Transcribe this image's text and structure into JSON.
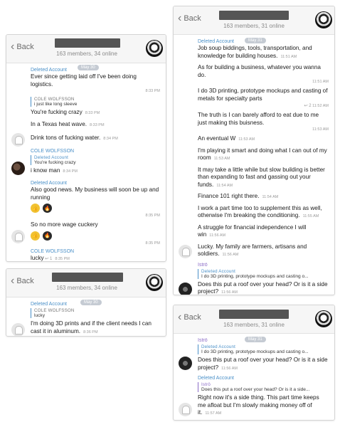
{
  "header": {
    "back_label": "Back",
    "members_a": "163 members, 34 online",
    "members_b": "163 members, 31 online"
  },
  "panel1": {
    "day": "May 30",
    "messages": [
      {
        "sender": "Deleted Account",
        "text": "Ever since getting laid off I've been doing logistics.",
        "time": "8:33 PM"
      },
      {
        "reply_name": "COLE WOLFSSON",
        "reply_text": "i just like long sleeve",
        "text": "You're fucking crazy",
        "time": "8:33 PM"
      },
      {
        "text": "In a Texas heat wave.",
        "time": "8:33 PM"
      },
      {
        "text": "Drink tons of fucking water.",
        "time": "8:34 PM"
      },
      {
        "sender": "COLE WOLFSSON",
        "reply_name": "Deleted Account",
        "reply_text": "You're fucking crazy",
        "text": "i know man",
        "time": "8:34 PM"
      },
      {
        "sender": "Deleted Account",
        "text": "Also good news. My business will soon be up and running",
        "time": "8:35 PM"
      },
      {
        "text": "So no more wage cuckery",
        "time": "8:35 PM"
      },
      {
        "sender": "COLE WOLFSSON",
        "text": "lucky",
        "time": "8:35 PM"
      }
    ]
  },
  "panel2": {
    "day": "May 30",
    "messages": [
      {
        "sender": "Deleted Account",
        "reply_name": "COLE WOLFSSON",
        "reply_text": "lucky",
        "text": "I'm doing 3D prints and if the client needs I can cast it in aluminum.",
        "time": "8:36 PM"
      }
    ]
  },
  "panel3": {
    "day": "May 31",
    "messages": [
      {
        "sender": "Deleted Account",
        "text": "Job soup biddings, tools, transportation, and knowledge for building houses.",
        "time": "11:51 AM"
      },
      {
        "text": "As for building a business, whatever you wanna do.",
        "time": "11:51 AM"
      },
      {
        "text": "I do 3D printing, prototype mockups and casting of metals for specialty parts",
        "time": "11:52 AM",
        "fwd": "2"
      },
      {
        "text": "The truth is I can barely afford to eat due to me just making this buisness.",
        "time": "11:53 AM"
      },
      {
        "text": "An eventual W",
        "time": "11:53 AM"
      },
      {
        "text": "I'm playing it smart and doing what I can out of my room",
        "time": "11:53 AM"
      },
      {
        "text": "It may take a little while but slow building is better than expanding to fast and gassing out your funds.",
        "time": "11:54 AM"
      },
      {
        "text": "Finance 101 right there.",
        "time": "11:54 AM"
      },
      {
        "text": "I work a part time too to supplement this as well, otherwise I'm breaking the conditioning.",
        "time": "11:55 AM"
      },
      {
        "text": "A struggle for financial independence I will win",
        "time": "11:56 AM"
      },
      {
        "text": "Lucky. My family are farmers, artisans and soldiers.",
        "time": "11:56 AM"
      },
      {
        "sender": "Iströ",
        "reply_name": "Deleted Account",
        "reply_text": "I do 3D printing, prototype mockups and casting o...",
        "text": "Does this put a roof over your head? Or is it a side project?",
        "time": "11:56 AM"
      }
    ]
  },
  "panel4": {
    "day": "May 31",
    "messages": [
      {
        "sender": "Iströ",
        "reply_name": "Deleted Account",
        "reply_text": "I do 3D printing, prototype mockups and casting o...",
        "text": "Does this put a roof over your head? Or is it a side project?",
        "time": "11:56 AM"
      },
      {
        "sender": "Deleted Account",
        "reply_name": "Iströ",
        "reply_text": "Does this put a roof over your head? Or is it a side...",
        "text": "Right now it's a side thing. This part time keeps me afloat but I'm slowly making money off of it.",
        "time": "11:57 AM"
      }
    ]
  }
}
